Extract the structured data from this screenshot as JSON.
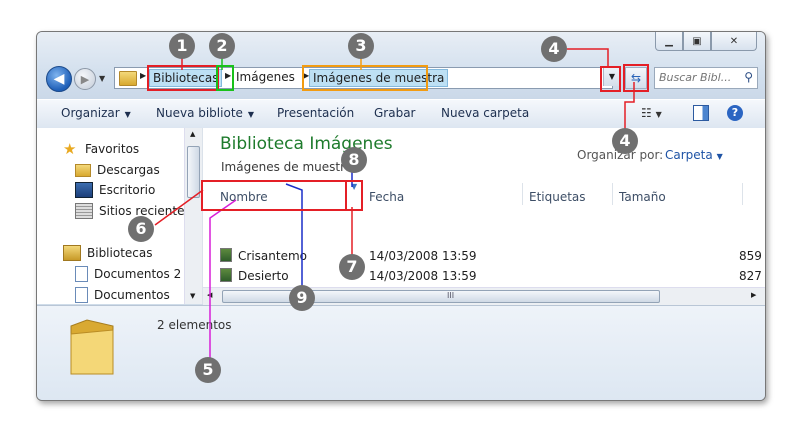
{
  "address_bar": {
    "crumbs": [
      "Bibliotecas",
      "Imágenes",
      "Imágenes de muestra"
    ]
  },
  "search": {
    "placeholder": "Buscar Bibl..."
  },
  "toolbar": {
    "organize": "Organizar",
    "new_library": "Nueva bibliote",
    "presentation": "Presentación",
    "burn": "Grabar",
    "new_folder": "Nueva carpeta"
  },
  "nav": {
    "favorites": "Favoritos",
    "items": [
      "Descargas",
      "Escritorio",
      "Sitios recientes"
    ],
    "libraries": "Bibliotecas",
    "lib_items": [
      "Documentos 2",
      "Documentos"
    ]
  },
  "content": {
    "title": "Biblioteca Imágenes",
    "subtitle": "Imágenes de muestra",
    "arrange_label": "Organizar por:",
    "arrange_value": "Carpeta",
    "columns": [
      "Nombre",
      "Fecha",
      "Etiquetas",
      "Tamaño"
    ],
    "rows": [
      {
        "name": "Crisantemo",
        "date": "14/03/2008 13:59",
        "size": "859"
      },
      {
        "name": "Desierto",
        "date": "14/03/2008 13:59",
        "size": "827"
      }
    ]
  },
  "details": {
    "count": "2 elementos"
  },
  "callouts": [
    "1",
    "2",
    "3",
    "4",
    "4",
    "5",
    "6",
    "7",
    "8",
    "9"
  ],
  "colors": {
    "callout_red": "#e41f26",
    "callout_green": "#19c11a",
    "callout_orange": "#f29c12",
    "callout_blue": "#1a2ec9",
    "callout_magenta": "#d71fd7",
    "badge": "#707070",
    "title_green": "#1e7b2c"
  }
}
